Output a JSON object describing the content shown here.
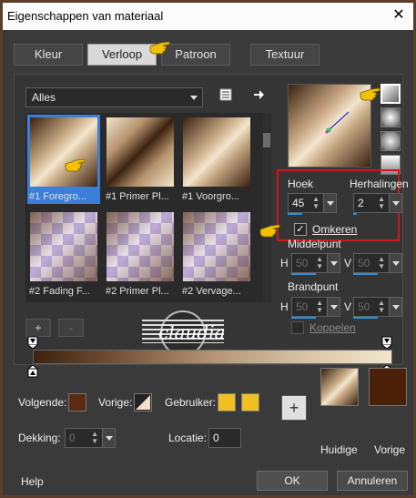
{
  "window": {
    "title": "Eigenschappen van materiaal",
    "close_glyph": "✕"
  },
  "tabs": [
    {
      "label": "Kleur",
      "active": false
    },
    {
      "label": "Verloop",
      "active": true
    },
    {
      "label": "Patroon",
      "active": false
    },
    {
      "label": "Textuur",
      "active": false
    }
  ],
  "gallery": {
    "filter_value": "Alles",
    "items": [
      {
        "label": "#1 Foregro...",
        "selected": true
      },
      {
        "label": "#1 Primer Pl...",
        "selected": false
      },
      {
        "label": "#1 Voorgro...",
        "selected": false
      },
      {
        "label": "#2 Fading F...",
        "selected": false
      },
      {
        "label": "#2 Primer Pl...",
        "selected": false
      },
      {
        "label": "#2 Vervage...",
        "selected": false
      }
    ]
  },
  "gradient_settings": {
    "angle_label": "Hoek",
    "angle_value": "45",
    "repeats_label": "Herhalingen",
    "repeats_value": "2",
    "invert_label": "Omkeren",
    "invert_checked": true,
    "center_label": "Middelpunt",
    "center_h_label": "H",
    "center_h_value": "50",
    "center_v_label": "V",
    "center_v_value": "50",
    "focal_label": "Brandpunt",
    "focal_h_label": "H",
    "focal_h_value": "50",
    "focal_v_label": "V",
    "focal_v_value": "50",
    "link_label": "Koppelen",
    "link_checked": false
  },
  "editor": {
    "add_glyph": "+",
    "remove_glyph": "-"
  },
  "watermark": {
    "text": "claudia"
  },
  "footer": {
    "follow_label": "Volgende:",
    "prev_label": "Vorige:",
    "user_label": "Gebruiker:",
    "opacity_label": "Dekking:",
    "opacity_value": "0",
    "location_label": "Locatie:",
    "location_value": "0",
    "add_swatch_glyph": "+",
    "current_label": "Huidige",
    "previous_label": "Vorige",
    "colors": {
      "follow_swatch": "#5a2a12",
      "user_swatch_1": "#f0c020",
      "user_swatch_2": "#f0c020",
      "previous_swatch": "#4a2008"
    }
  },
  "bottom": {
    "help_label": "Help",
    "ok_label": "OK",
    "cancel_label": "Annuleren"
  }
}
